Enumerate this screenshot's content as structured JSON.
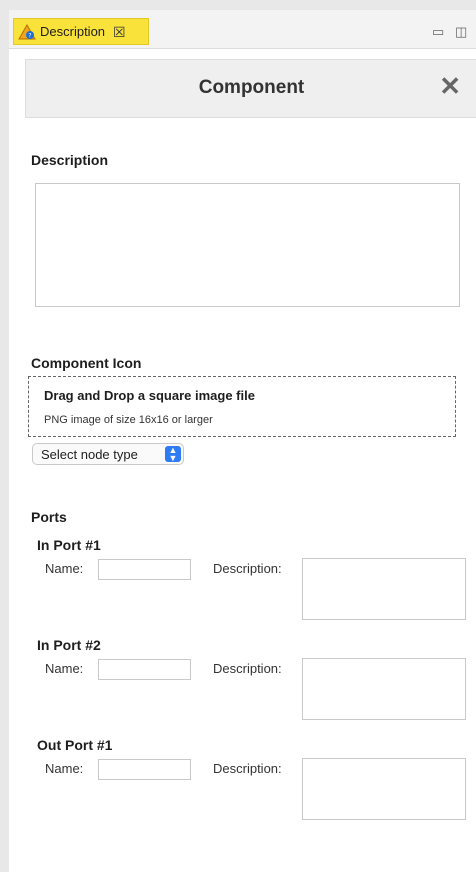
{
  "tab": {
    "label": "Description",
    "close_glyph": "☒"
  },
  "view_controls": {
    "minimize": "▭",
    "maximize": "◫"
  },
  "header": {
    "title": "Component",
    "close_glyph": "✕"
  },
  "description": {
    "label": "Description",
    "value": ""
  },
  "icon_section": {
    "label": "Component Icon",
    "drop_title": "Drag and Drop a square image file",
    "drop_subtitle": "PNG image of size 16x16 or larger",
    "select_value": "Select node type"
  },
  "ports": {
    "label": "Ports",
    "items": [
      {
        "title": "In Port #1",
        "name_label": "Name:",
        "desc_label": "Description:",
        "name_value": "",
        "desc_value": ""
      },
      {
        "title": "In Port #2",
        "name_label": "Name:",
        "desc_label": "Description:",
        "name_value": "",
        "desc_value": ""
      },
      {
        "title": "Out Port #1",
        "name_label": "Name:",
        "desc_label": "Description:",
        "name_value": "",
        "desc_value": ""
      }
    ]
  },
  "colors": {
    "tab_highlight": "#f9e23a",
    "select_accent": "#2f7bf6",
    "header_bg": "#efefef"
  }
}
